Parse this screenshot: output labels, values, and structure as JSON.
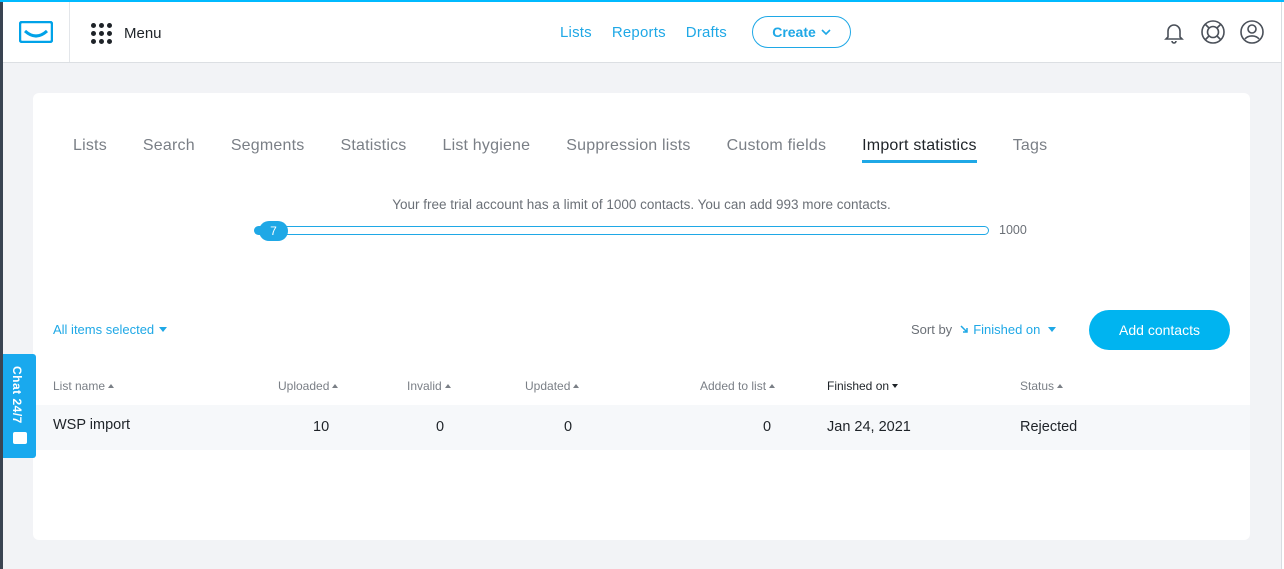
{
  "header": {
    "menu_label": "Menu",
    "nav": [
      "Lists",
      "Reports",
      "Drafts"
    ],
    "create_label": "Create",
    "icons": [
      "notification-bell-icon",
      "help-lifebuoy-icon",
      "user-account-icon"
    ]
  },
  "tabs": [
    {
      "label": "Lists",
      "active": false
    },
    {
      "label": "Search",
      "active": false
    },
    {
      "label": "Segments",
      "active": false
    },
    {
      "label": "Statistics",
      "active": false
    },
    {
      "label": "List hygiene",
      "active": false
    },
    {
      "label": "Suppression lists",
      "active": false
    },
    {
      "label": "Custom fields",
      "active": false
    },
    {
      "label": "Import statistics",
      "active": true
    },
    {
      "label": "Tags",
      "active": false
    }
  ],
  "limit": {
    "message": "Your free trial account has a limit of 1000 contacts. You can add 993 more contacts.",
    "current": "7",
    "max": "1000",
    "fraction": 0.007
  },
  "toolbar": {
    "selection_label": "All items selected",
    "sort_label": "Sort by",
    "sort_value": "Finished on",
    "add_button": "Add contacts"
  },
  "table": {
    "columns": [
      "List name",
      "Uploaded",
      "Invalid",
      "Updated",
      "Added to list",
      "Finished on",
      "Status"
    ],
    "rows": [
      {
        "list_name": "WSP import",
        "uploaded": "10",
        "invalid": "0",
        "updated": "0",
        "added": "0",
        "finished_on": "Jan 24, 2021",
        "status": "Rejected"
      }
    ]
  },
  "chat": {
    "label": "Chat 24/7"
  },
  "colors": {
    "accent": "#1fa8e6",
    "button": "#00b4f0"
  }
}
